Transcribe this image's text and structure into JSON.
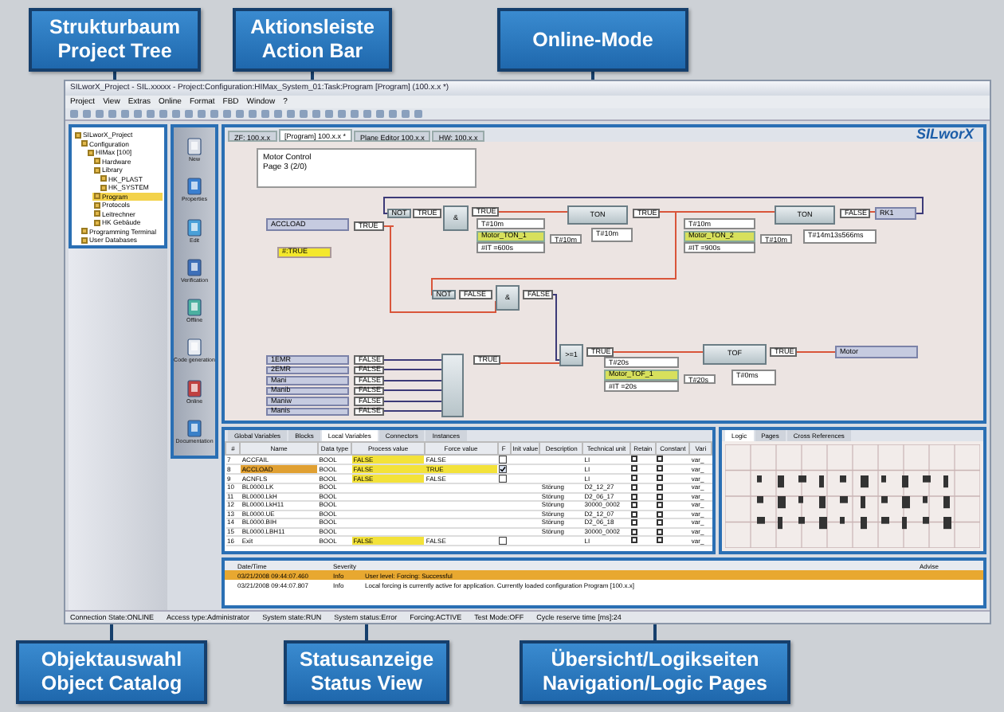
{
  "callouts": [
    {
      "lines": [
        "Strukturbaum",
        "Project Tree"
      ]
    },
    {
      "lines": [
        "Aktionsleiste",
        "Action Bar"
      ]
    },
    {
      "lines": [
        "Online-Mode"
      ]
    },
    {
      "lines": [
        "Objektauswahl",
        "Object Catalog"
      ]
    },
    {
      "lines": [
        "Statusanzeige",
        "Status View"
      ]
    },
    {
      "lines": [
        "Übersicht/Logikseiten",
        "Navigation/Logic Pages"
      ]
    }
  ],
  "window": {
    "title": "SILworX_Project - SIL.xxxxx - Project:Configuration:HIMax_System_01:Task:Program [Program] (100.x.x *)",
    "menu": [
      "Project",
      "View",
      "Extras",
      "Online",
      "Format",
      "FBD",
      "Window",
      "?"
    ],
    "status_bar": [
      "Connection State:ONLINE",
      "Access type:Administrator",
      "System state:RUN",
      "System status:Error",
      "Forcing:ACTIVE",
      "Test Mode:OFF",
      "Cycle reserve time [ms]:24"
    ]
  },
  "project_tree": [
    {
      "label": "SILworX_Project",
      "selected": false,
      "children": [
        {
          "label": "Configuration",
          "selected": false,
          "children": [
            {
              "label": "HIMax [100]",
              "selected": false,
              "children": [
                {
                  "label": "Hardware",
                  "selected": false
                },
                {
                  "label": "Library",
                  "selected": false,
                  "children": [
                    {
                      "label": "HK_PLAST",
                      "selected": false
                    },
                    {
                      "label": "HK_SYSTEM",
                      "selected": false
                    }
                  ]
                },
                {
                  "label": "Program",
                  "selected": true
                },
                {
                  "label": "Protocols",
                  "selected": false
                },
                {
                  "label": "Leitrechner",
                  "selected": false
                },
                {
                  "label": "HK Gebäude",
                  "selected": false
                }
              ]
            }
          ]
        },
        {
          "label": "Programming Terminal",
          "selected": false
        },
        {
          "label": "User Databases",
          "selected": false
        }
      ]
    }
  ],
  "action_bar": [
    {
      "label": "New"
    },
    {
      "label": "Properties"
    },
    {
      "label": "Edit"
    },
    {
      "label": "Verification"
    },
    {
      "label": "Offline"
    },
    {
      "label": "Code generation"
    },
    {
      "label": "Online"
    },
    {
      "label": "Documentation"
    }
  ],
  "editor": {
    "tabs": [
      {
        "label": "ZF: 100.x.x",
        "selected": false
      },
      {
        "label": "[Program] 100.x.x *",
        "selected": true
      },
      {
        "label": "Plane Editor 100.x.x",
        "selected": false
      },
      {
        "label": "HW: 100.x.x",
        "selected": false
      }
    ],
    "logo": "SILworX",
    "comment": [
      "Motor Control",
      "Page 3 (2/0)"
    ],
    "nodes": [
      {
        "kind": "variable",
        "text": "ACCLOAD"
      },
      {
        "kind": "value",
        "text": "TRUE"
      },
      {
        "kind": "force",
        "text": "#:TRUE"
      },
      {
        "kind": "block",
        "text": "NOT"
      },
      {
        "kind": "value",
        "text": "TRUE"
      },
      {
        "kind": "block",
        "text": "&"
      },
      {
        "kind": "value",
        "text": "TRUE"
      },
      {
        "kind": "param",
        "text": "T#10m"
      },
      {
        "kind": "instance",
        "text": "Motor_TON_1"
      },
      {
        "kind": "param",
        "text": "#IT =600s"
      },
      {
        "kind": "param",
        "text": "T#10m"
      },
      {
        "kind": "block",
        "text": "TON"
      },
      {
        "kind": "param",
        "text": "T#10m"
      },
      {
        "kind": "value",
        "text": "TRUE"
      },
      {
        "kind": "param",
        "text": "T#10m"
      },
      {
        "kind": "instance",
        "text": "Motor_TON_2"
      },
      {
        "kind": "param",
        "text": "#IT =900s"
      },
      {
        "kind": "param",
        "text": "T#10m"
      },
      {
        "kind": "block",
        "text": "TON"
      },
      {
        "kind": "param",
        "text": "T#14m13s566ms"
      },
      {
        "kind": "value",
        "text": "FALSE"
      },
      {
        "kind": "variable",
        "text": "RK1"
      },
      {
        "kind": "block",
        "text": "NOT"
      },
      {
        "kind": "value",
        "text": "FALSE"
      },
      {
        "kind": "block",
        "text": "&"
      },
      {
        "kind": "value",
        "text": "FALSE"
      },
      {
        "kind": "block",
        "text": ">=1"
      },
      {
        "kind": "value",
        "text": "TRUE"
      },
      {
        "kind": "param",
        "text": "T#20s"
      },
      {
        "kind": "instance",
        "text": "Motor_TOF_1"
      },
      {
        "kind": "param",
        "text": "#IT =20s"
      },
      {
        "kind": "param",
        "text": "T#20s"
      },
      {
        "kind": "block",
        "text": "TOF"
      },
      {
        "kind": "param",
        "text": "T#0ms"
      },
      {
        "kind": "value",
        "text": "TRUE"
      },
      {
        "kind": "variable",
        "text": "Motor"
      },
      {
        "kind": "variable",
        "text": "1EMR"
      },
      {
        "kind": "value",
        "text": "FALSE"
      },
      {
        "kind": "multi"
      },
      {
        "kind": "value",
        "text": "TRUE"
      },
      {
        "kind": "variable",
        "text": "2EMR"
      },
      {
        "kind": "value",
        "text": "FALSE"
      },
      {
        "kind": "variable",
        "text": "Mani"
      },
      {
        "kind": "value",
        "text": "FALSE"
      },
      {
        "kind": "variable",
        "text": "Manib"
      },
      {
        "kind": "value",
        "text": "FALSE"
      },
      {
        "kind": "variable",
        "text": "Maniw"
      },
      {
        "kind": "value",
        "text": "FALSE"
      },
      {
        "kind": "variable",
        "text": "Manis"
      },
      {
        "kind": "value",
        "text": "FALSE"
      }
    ]
  },
  "object_catalog": {
    "tabs": [
      {
        "label": "Global Variables",
        "selected": false
      },
      {
        "label": "Blocks",
        "selected": false
      },
      {
        "label": "Local Variables",
        "selected": true
      },
      {
        "label": "Connectors",
        "selected": false
      },
      {
        "label": "Instances",
        "selected": false
      }
    ],
    "columns": [
      "#",
      "Name",
      "Data type",
      "Process value",
      "Force value",
      "F",
      "Init value",
      "Description",
      "Technical unit",
      "Retain",
      "Constant",
      "Vari"
    ],
    "rows": [
      {
        "num": "7",
        "name": "ACCFAIL",
        "type": "BOOL",
        "process": "FALSE",
        "force": "FALSE",
        "forceable": true,
        "force_checked": false,
        "description": "",
        "unit": "LI",
        "var": "var_",
        "selected": false,
        "marked": true
      },
      {
        "num": "8",
        "name": "ACCLOAD",
        "type": "BOOL",
        "process": "FALSE",
        "force": "TRUE",
        "forceable": true,
        "force_checked": true,
        "description": "",
        "unit": "LI",
        "var": "var_",
        "selected": true,
        "marked": true
      },
      {
        "num": "9",
        "name": "ACNFLS",
        "type": "BOOL",
        "process": "FALSE",
        "force": "FALSE",
        "forceable": true,
        "force_checked": false,
        "description": "",
        "unit": "LI",
        "var": "var_",
        "selected": false,
        "marked": true
      },
      {
        "num": "10",
        "name": "BL0000.LK",
        "type": "BOOL",
        "forceable": false,
        "description": "Störung",
        "unit": "D2_12_27",
        "var": "var_",
        "selected": false,
        "marked": false
      },
      {
        "num": "11",
        "name": "BL0000.LkH",
        "type": "BOOL",
        "forceable": false,
        "description": "Störung",
        "unit": "D2_06_17",
        "var": "var_",
        "selected": false,
        "marked": false
      },
      {
        "num": "12",
        "name": "BL0000.LkH11",
        "type": "BOOL",
        "forceable": false,
        "description": "Störung",
        "unit": "30000_0002",
        "var": "var_",
        "selected": false,
        "marked": false
      },
      {
        "num": "13",
        "name": "BL0000.UE",
        "type": "BOOL",
        "forceable": false,
        "description": "Störung",
        "unit": "D2_12_07",
        "var": "var_",
        "selected": false,
        "marked": false
      },
      {
        "num": "14",
        "name": "BL0000.BIH",
        "type": "BOOL",
        "forceable": false,
        "description": "Störung",
        "unit": "D2_06_18",
        "var": "var_",
        "selected": false,
        "marked": false
      },
      {
        "num": "15",
        "name": "BL0000.LBH11",
        "type": "BOOL",
        "forceable": false,
        "description": "Störung",
        "unit": "30000_0002",
        "var": "var_",
        "selected": false,
        "marked": false
      },
      {
        "num": "16",
        "name": "Exit",
        "type": "BOOL",
        "process": "FALSE",
        "force": "FALSE",
        "forceable": true,
        "force_checked": false,
        "description": "",
        "unit": "LI",
        "var": "var_",
        "selected": false,
        "marked": true
      }
    ]
  },
  "navigation": {
    "tabs": [
      {
        "label": "Logic",
        "selected": true
      },
      {
        "label": "Pages",
        "selected": false
      },
      {
        "label": "Cross References",
        "selected": false
      }
    ]
  },
  "status_view": {
    "columns": [
      "Date/Time",
      "Severity",
      "Advise"
    ],
    "rows": [
      {
        "date": "03/21/2008 09:44:07.460",
        "severity": "Info",
        "message": "User level: Forcing: Successful",
        "selected": true
      },
      {
        "date": "03/21/2008 09:44:07.807",
        "severity": "Info",
        "message": "Local forcing is currently active for application. Currently loaded configuration Program [100.x.x]",
        "selected": false
      }
    ]
  }
}
